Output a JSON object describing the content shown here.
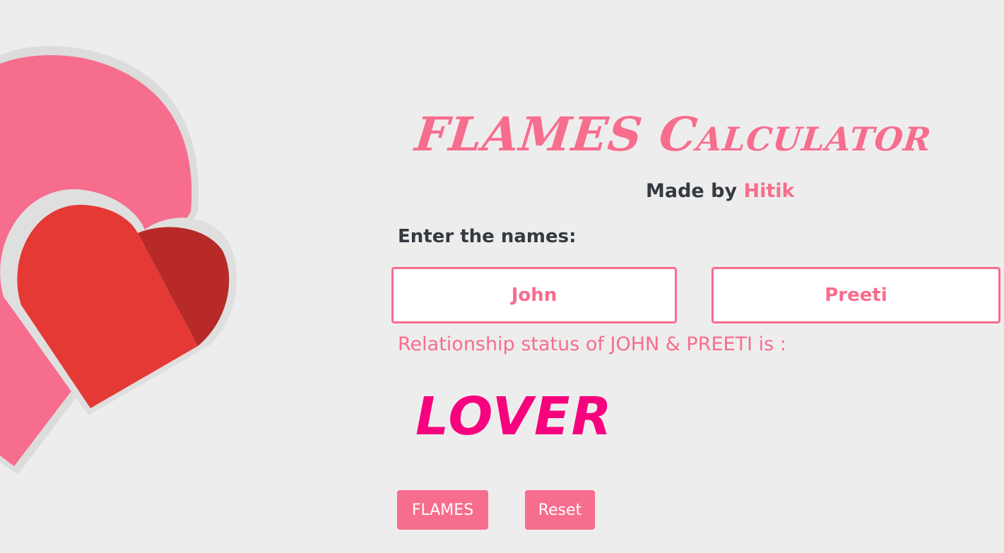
{
  "colors": {
    "background": "#eeeded",
    "accent": "#f76d8d",
    "result": "#f7027e",
    "dark_text": "#343a40",
    "heart_back": "#f76d8d",
    "heart_front": "#e53935",
    "heart_front_shade": "#b72a28"
  },
  "header": {
    "title_part1": "FLAMES ",
    "title_part2": "Calculator",
    "byline_prefix": "Made by ",
    "byline_author": "Hitik"
  },
  "form": {
    "label": "Enter the names:",
    "name1_value": "John",
    "name2_value": "Preeti"
  },
  "result": {
    "status_text": "Relationship status of JOHN & PREETI is :",
    "value": "LOVER"
  },
  "buttons": {
    "flames_label": "FLAMES",
    "reset_label": "Reset"
  },
  "icons": {
    "decoration": "hearts-illustration"
  }
}
